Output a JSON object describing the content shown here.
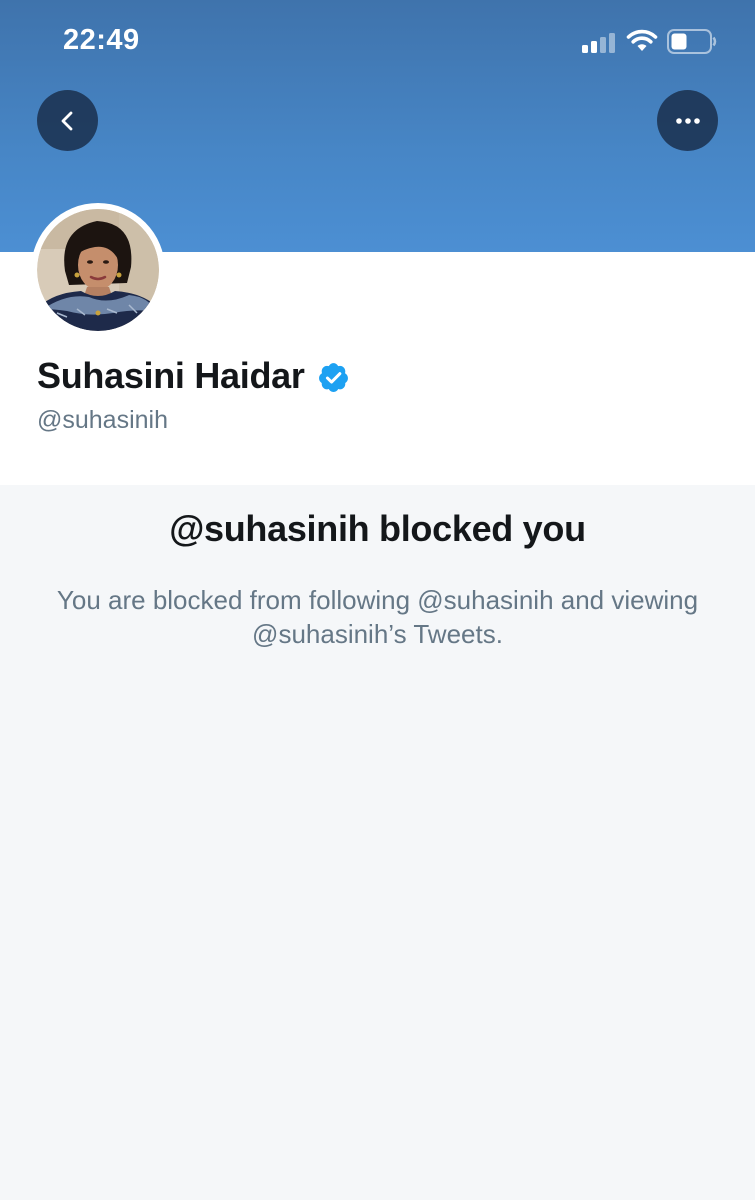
{
  "status_bar": {
    "time": "22:49",
    "icons": [
      "signal-icon",
      "wifi-icon",
      "battery-icon"
    ]
  },
  "header": {
    "back_icon": "chevron-left-icon",
    "more_icon": "more-horizontal-icon",
    "banner_color": "#4786c6"
  },
  "profile": {
    "display_name": "Suhasini Haidar",
    "handle": "@suhasinih",
    "verified": true,
    "verified_color": "#1da1f2"
  },
  "blocked_notice": {
    "title": "@suhasinih blocked you",
    "message": "You are blocked from following @suhasinih and viewing @suhasinih’s Tweets."
  }
}
